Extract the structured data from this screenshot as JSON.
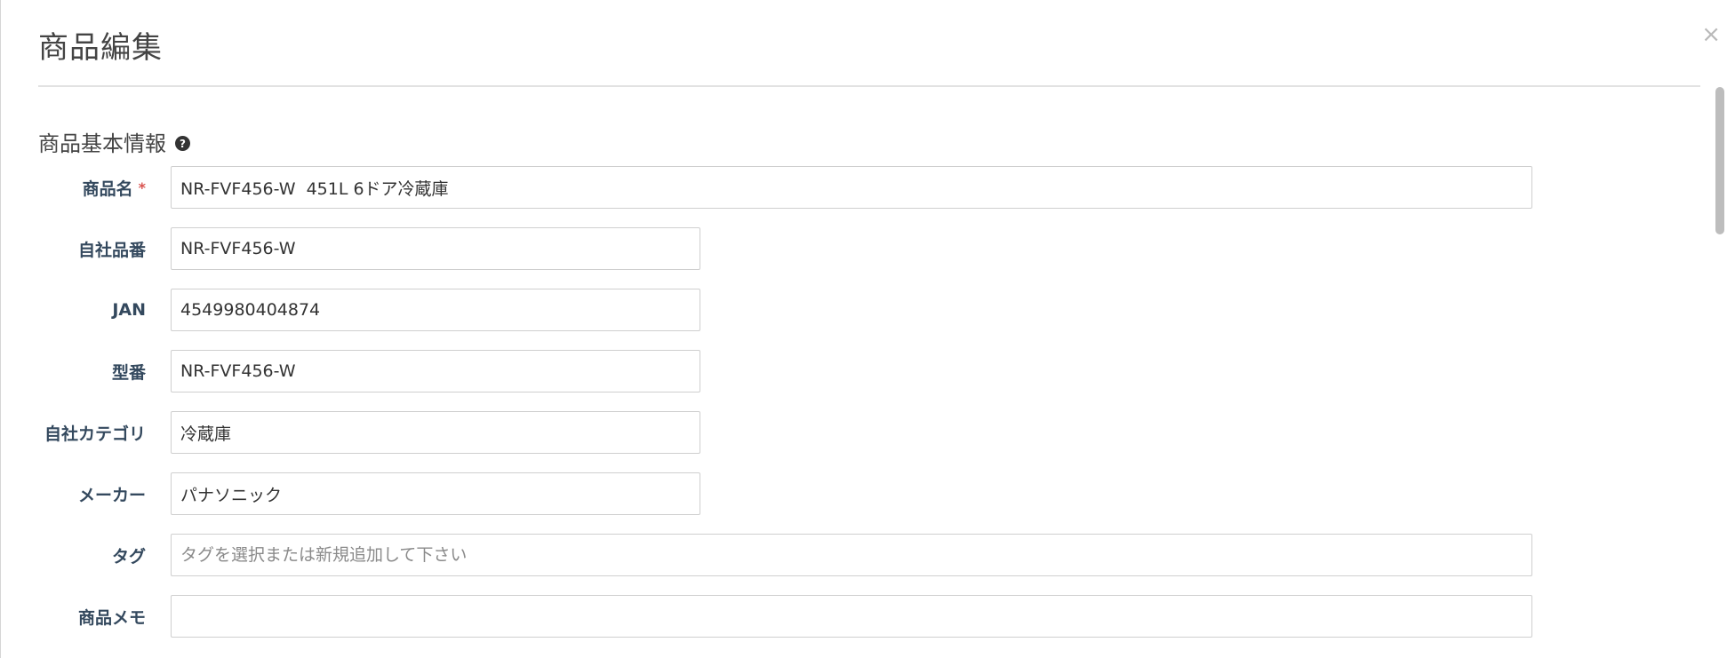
{
  "modal": {
    "title": "商品編集",
    "close_label": "×"
  },
  "section": {
    "title": "商品基本情報",
    "help_icon": "?"
  },
  "form": {
    "product_name": {
      "label": "商品名",
      "required_mark": "*",
      "value": "NR-FVF456-W  451L 6ドア冷蔵庫"
    },
    "own_code": {
      "label": "自社品番",
      "value": "NR-FVF456-W"
    },
    "jan": {
      "label": "JAN",
      "value": "4549980404874"
    },
    "model": {
      "label": "型番",
      "value": "NR-FVF456-W"
    },
    "own_category": {
      "label": "自社カテゴリ",
      "value": "冷蔵庫"
    },
    "maker": {
      "label": "メーカー",
      "value": "パナソニック"
    },
    "tag": {
      "label": "タグ",
      "value": "",
      "placeholder": "タグを選択または新規追加して下さい"
    },
    "memo": {
      "label": "商品メモ",
      "value": ""
    }
  }
}
